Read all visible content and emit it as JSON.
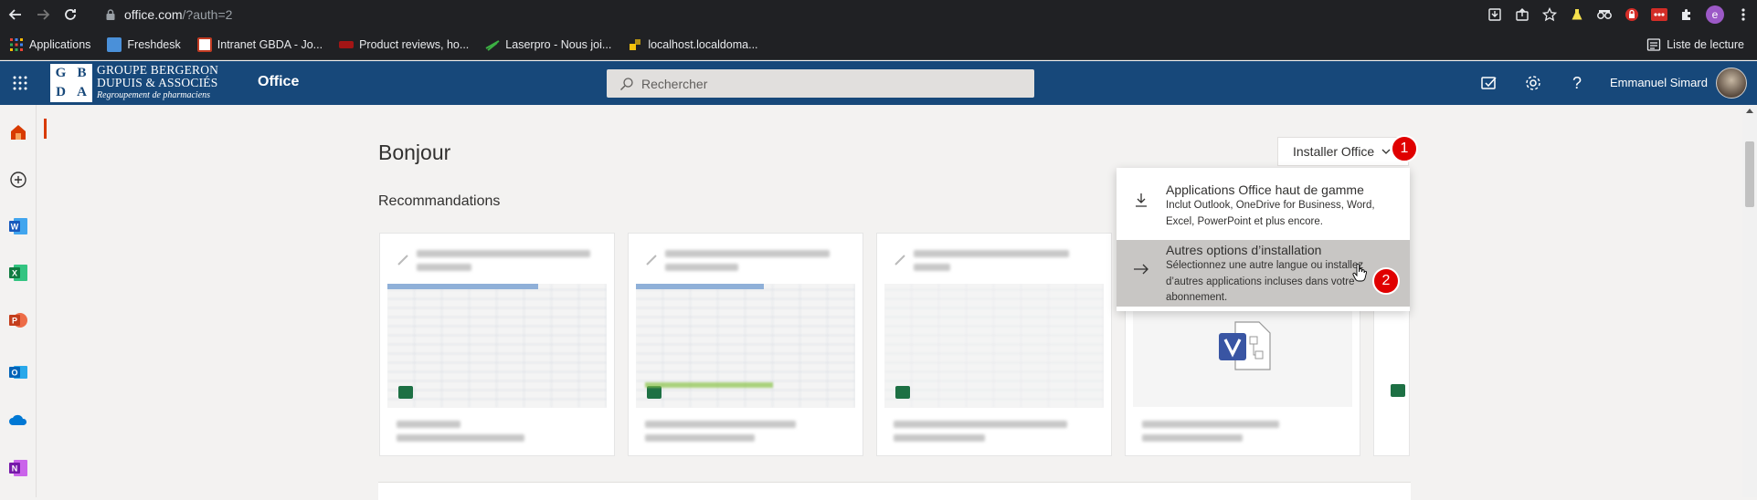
{
  "browser": {
    "url_host": "office.com",
    "url_path": "/?auth=2",
    "bookmarks": [
      {
        "label": "Applications",
        "color": "#e8453c"
      },
      {
        "label": "Freshdesk",
        "color": "#4a90d9"
      },
      {
        "label": "Intranet GBDA - Jo...",
        "color": "#c23b22"
      },
      {
        "label": "Product reviews, ho...",
        "color": "#a31515"
      },
      {
        "label": "Laserpro - Nous joi...",
        "color": "#3cb043"
      },
      {
        "label": "localhost.localdoma...",
        "color": "#f4c20d"
      }
    ],
    "reading_list": "Liste de lecture",
    "profile_initial": "e"
  },
  "header": {
    "logo_letters": [
      "G",
      "B",
      "D",
      "A"
    ],
    "logo_line1": "GROUPE BERGERON",
    "logo_line2": "DUPUIS & ASSOCIÉS",
    "logo_line3": "Regroupement de pharmaciens",
    "app_name": "Office",
    "search_placeholder": "Rechercher",
    "help": "?",
    "user_name": "Emmanuel Simard"
  },
  "main": {
    "greeting": "Bonjour",
    "recommendations_title": "Recommandations",
    "install_button": "Installer Office",
    "badge1": "1",
    "badge2": "2"
  },
  "dropdown": {
    "items": [
      {
        "title": "Applications Office haut de gamme",
        "description": "Inclut Outlook, OneDrive for Business, Word, Excel, PowerPoint et plus encore."
      },
      {
        "title": "Autres options d’installation",
        "description": "Sélectionnez une autre langue ou installez d’autres applications incluses dans votre abonnement."
      }
    ]
  },
  "colors": {
    "office_header": "#17487a",
    "accent_orange": "#d83b01",
    "badge_red": "#e00000"
  }
}
